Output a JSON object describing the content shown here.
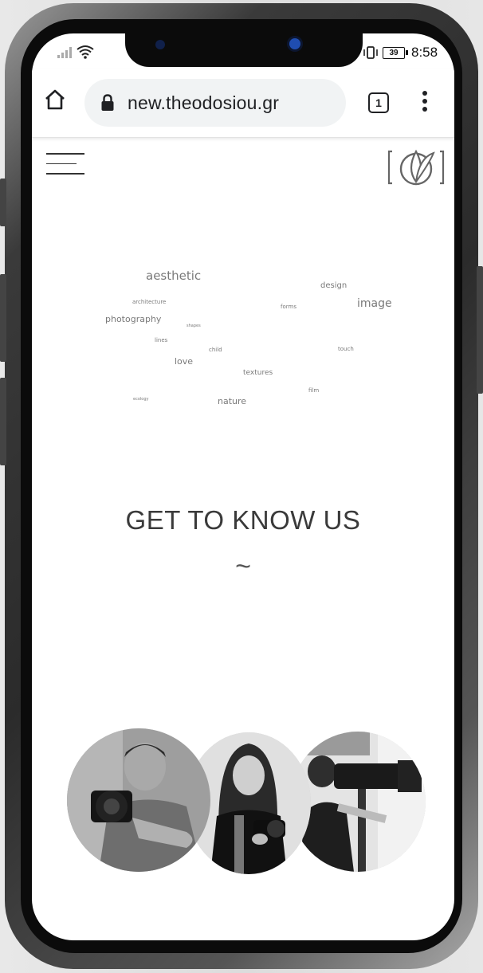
{
  "status_bar": {
    "time": "8:58",
    "battery": "39"
  },
  "browser": {
    "url": "new.theodosiou.gr",
    "tab_count": "1"
  },
  "word_cloud": [
    {
      "text": "aesthetic"
    },
    {
      "text": "design"
    },
    {
      "text": "architecture"
    },
    {
      "text": "forms"
    },
    {
      "text": "image"
    },
    {
      "text": "photography"
    },
    {
      "text": "shapes"
    },
    {
      "text": "lines"
    },
    {
      "text": "child"
    },
    {
      "text": "touch"
    },
    {
      "text": "love"
    },
    {
      "text": "textures"
    },
    {
      "text": "film"
    },
    {
      "text": "ecology"
    },
    {
      "text": "nature"
    }
  ],
  "section": {
    "headline": "GET TO KNOW US",
    "divider": "~"
  },
  "team": [
    {
      "name": "photographer-man"
    },
    {
      "name": "photographer-woman"
    },
    {
      "name": "videographer"
    }
  ]
}
